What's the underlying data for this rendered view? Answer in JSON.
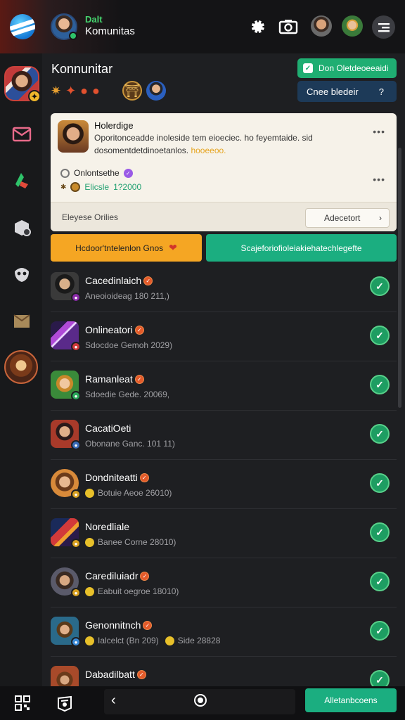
{
  "header": {
    "small_title": "Dalt",
    "title": "Komunitas"
  },
  "community": {
    "title": "Konnunitar",
    "primary_button": "Don Oletdeoeeaidi",
    "secondary_button": "Cnee bledeir",
    "secondary_button_icon": "?"
  },
  "card": {
    "name": "Holerdige",
    "text": "Oporitonceadde inoleside tem eioeciec. ho feyemtaide. sid",
    "text2": "dosomentdetdinoetanlos.",
    "highlight": "hooeeoo.",
    "sub_label": "Onlontsethe",
    "stat_label": "Elicsle",
    "stat_value": "1?2000",
    "footer_label": "Eleyese Orilies",
    "footer_button": "Adecetort",
    "more_icon": "more-dots-icon"
  },
  "actions": {
    "orange_label": "Hcdoor'tntelenlon Gnos",
    "teal_label": "Scajeforiofioleiakiehatechlegefte"
  },
  "list": [
    {
      "name": "Cacedinlaich",
      "meta": "Aneoioideag 180 211,)",
      "badge_color": "#8a2aa8"
    },
    {
      "name": "Onlineatori",
      "meta": "Sdocdoe Gemoh 2029)",
      "badge_color": "#d23a3a"
    },
    {
      "name": "Ramanleat",
      "meta": "Sdoedie Gede. 20069,",
      "badge_color": "#2aa85a"
    },
    {
      "name": "CacatiOeti",
      "meta": "Obonane Ganc. 101 11)",
      "badge_color": "#3a6ab8"
    },
    {
      "name": "Dondniteatti",
      "meta": "Botuie Aeoe 26010)",
      "badge_color": "#d8a020"
    },
    {
      "name": "Noredliale",
      "meta": "Banee Corne 28010)",
      "badge_color": "#d8a020"
    },
    {
      "name": "Carediluiadr",
      "meta": "Eabuit oegroe 18010)",
      "badge_color": "#d8a020"
    },
    {
      "name": "Genonnitnch",
      "meta": "Ialcelct (Bn 209)",
      "meta2": "Side 28828",
      "badge_color": "#3a8ad8"
    },
    {
      "name": "Dabadilbatt",
      "meta": "",
      "badge_color": "#d8a020"
    }
  ],
  "bottom": {
    "button_label": "Alletanbcoens"
  },
  "colors": {
    "accent_green": "#1bae80",
    "accent_orange": "#f5a623",
    "badge_orange": "#e35a2a"
  }
}
